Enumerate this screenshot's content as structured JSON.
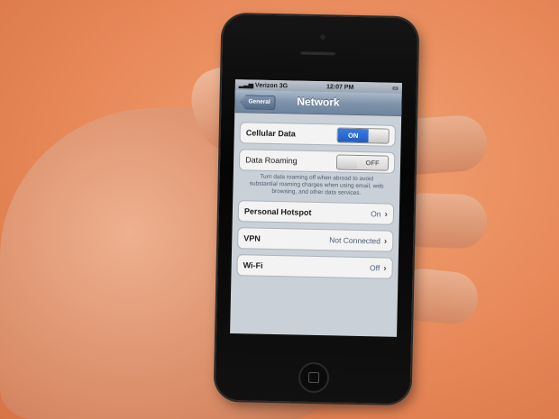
{
  "status_bar": {
    "carrier": "Verizon",
    "network": "3G",
    "time": "12:07 PM"
  },
  "nav": {
    "back_label": "General",
    "title": "Network"
  },
  "settings": {
    "cellular_data": {
      "label": "Cellular Data",
      "state": "ON"
    },
    "data_roaming": {
      "label": "Data Roaming",
      "state": "OFF"
    },
    "roaming_note": "Turn data roaming off when abroad to avoid substantial roaming charges when using email, web browsing, and other data services.",
    "personal_hotspot": {
      "label": "Personal Hotspot",
      "value": "On"
    },
    "vpn": {
      "label": "VPN",
      "value": "Not Connected"
    },
    "wifi": {
      "label": "Wi-Fi",
      "value": "Off"
    }
  },
  "colors": {
    "toggle_on": "#2b6ad6",
    "nav_bar": "#7f92aa",
    "background": "#c9d0d8"
  }
}
